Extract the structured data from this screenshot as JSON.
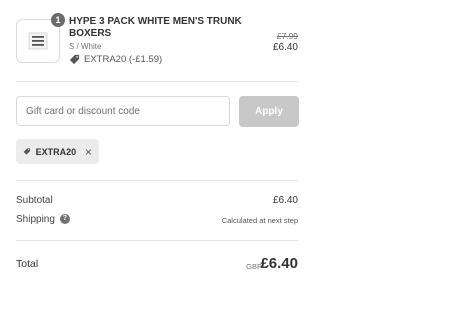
{
  "product": {
    "quantity": "1",
    "name": "HYPE 3 PACK WHITE MEN'S TRUNK BOXERS",
    "variant": "S / White",
    "discount": "EXTRA20 (-£1.59)",
    "price_original": "£7.99",
    "price_final": "£6.40",
    "thumbnail_icon": "boxers-thumbnail-icon"
  },
  "discount_form": {
    "placeholder": "Gift card or discount code",
    "value": "",
    "apply_label": "Apply"
  },
  "applied_code": {
    "code": "EXTRA20",
    "tag_icon": "tag-icon",
    "remove_icon": "close-icon"
  },
  "summary": {
    "subtotal_label": "Subtotal",
    "subtotal_value": "£6.40",
    "shipping_label": "Shipping",
    "shipping_help": "?",
    "shipping_value": "Calculated at next step",
    "total_label": "Total",
    "currency": "GBP",
    "total_value": "£6.40"
  }
}
